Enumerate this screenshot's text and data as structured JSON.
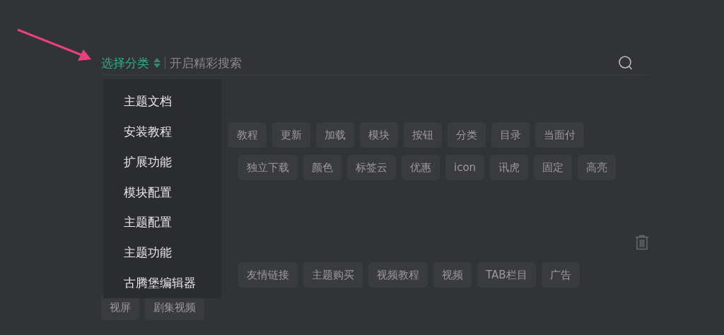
{
  "search": {
    "category_label": "选择分类",
    "placeholder": "开启精彩搜索"
  },
  "category_menu": {
    "items": [
      "主题文档",
      "安装教程",
      "扩展功能",
      "模块配置",
      "主题配置",
      "主题功能",
      "古腾堡编辑器"
    ]
  },
  "sections": [
    {
      "deletable": false,
      "lines": [
        {
          "tags": [
            "教程",
            "更新",
            "加载",
            "模块",
            "按钮",
            "分类",
            "目录",
            "当面付"
          ]
        },
        {
          "tags": [
            "独立下载",
            "颜色",
            "标签云",
            "优惠",
            "icon",
            "讯虎",
            "固定",
            "高亮"
          ]
        }
      ]
    },
    {
      "deletable": true,
      "lines": [
        {
          "tags": [
            "友情链接",
            "主题购买",
            "视频教程",
            "视频",
            "TAB栏目",
            "广告"
          ]
        },
        {
          "tags": [
            "视屏",
            "剧集视频"
          ]
        }
      ]
    }
  ]
}
